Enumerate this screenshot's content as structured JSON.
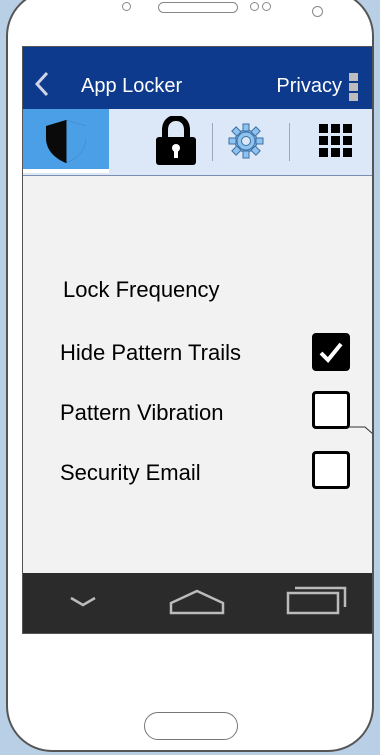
{
  "app_bar": {
    "title": "App Locker",
    "menu_label": "Privacy"
  },
  "tabs": [
    {
      "name": "shield",
      "icon": "shield-icon",
      "active": true
    },
    {
      "name": "lock",
      "icon": "lock-icon",
      "active": false
    },
    {
      "name": "settings",
      "icon": "gear-icon",
      "active": false
    },
    {
      "name": "apps",
      "icon": "grid-icon",
      "active": false
    }
  ],
  "settings": {
    "lock_frequency": "Lock Frequency",
    "items": [
      {
        "label": "Hide Pattern Trails",
        "checked": true
      },
      {
        "label": "Pattern Vibration",
        "checked": false
      },
      {
        "label": "Security Email",
        "checked": false
      }
    ]
  },
  "nav": [
    "back-icon",
    "home-icon",
    "recent-apps-icon"
  ],
  "colors": {
    "app_bar": "#0d3a8d",
    "active_tab": "#4a9fe6",
    "tab_bar": "#dce7f7",
    "nav_bar": "#2b2b2b"
  }
}
